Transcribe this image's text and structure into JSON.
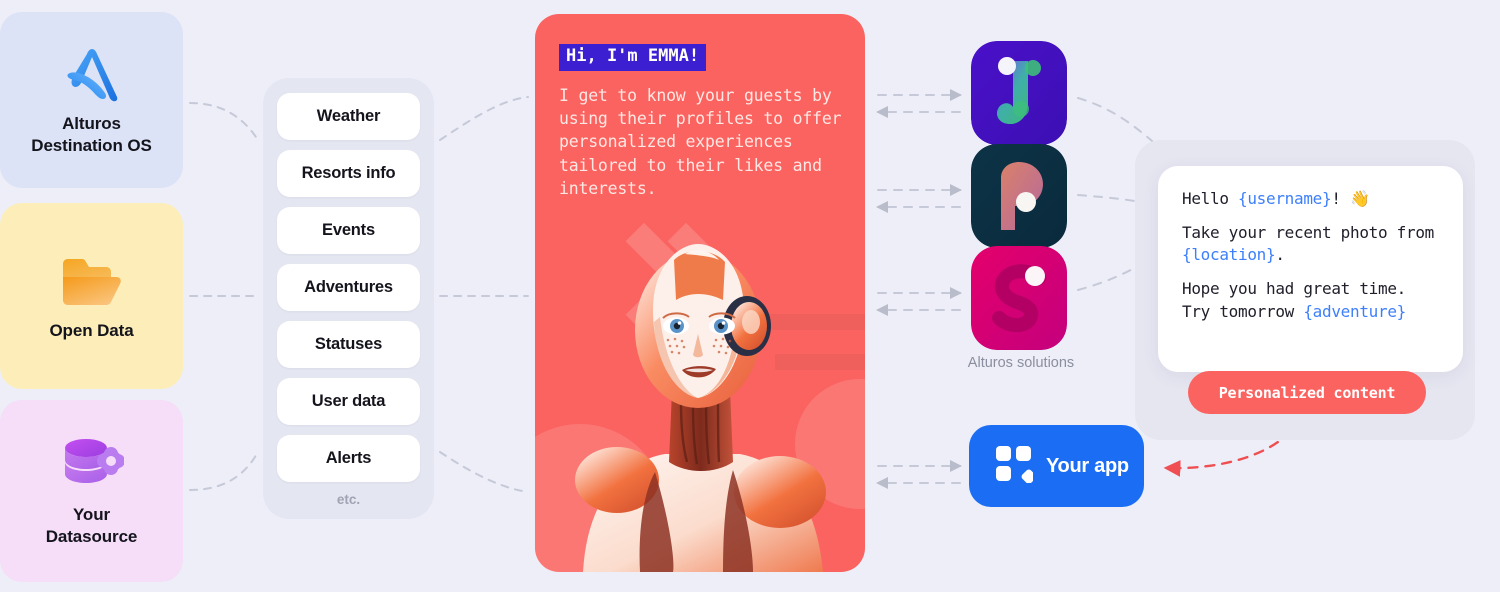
{
  "page": {
    "background_color": "#edeef7",
    "accent_red": "#fb6360",
    "accent_blue": "#1b6ef3",
    "token_blue": "#3d7ffb",
    "highlight_purple": "#3b1fd0"
  },
  "sources": [
    {
      "label": "Alturos\nDestination OS",
      "icon": "alturos-a-logo-icon",
      "bg": "#dde3f6"
    },
    {
      "label": "Open Data",
      "icon": "folder-icon",
      "bg": "#fdeeb9"
    },
    {
      "label": "Your\nDatasource",
      "icon": "database-gear-icon",
      "bg": "#f6ddf8"
    }
  ],
  "data_list": {
    "items": [
      "Weather",
      "Resorts info",
      "Events",
      "Adventures",
      "Statuses",
      "User data",
      "Alerts"
    ],
    "footer": "etc."
  },
  "emma": {
    "title": "Hi, I'm EMMA!",
    "body": "I get to know your guests by using their profiles to offer personalized experiences tailored to their likes and interests.",
    "image": "humanoid-robot-illustration"
  },
  "solutions": {
    "label": "Alturos solutions",
    "logos": [
      {
        "letter": "J",
        "name": "alturos-j-app-logo"
      },
      {
        "letter": "P",
        "name": "alturos-p-app-logo"
      },
      {
        "letter": "S",
        "name": "alturos-s-app-logo"
      }
    ]
  },
  "chat": {
    "line1_a": "Hello ",
    "line1_token": "{username}",
    "line1_b": "! 👋",
    "line2_a": "Take your recent photo from ",
    "line2_token": "{location}",
    "line2_b": ".",
    "line3_a": "Hope you had great time. Try tomorrow ",
    "line3_token": "{adventure}",
    "badge": "Personalized content"
  },
  "your_app": {
    "label": "Your app",
    "icon": "app-grid-icon"
  }
}
